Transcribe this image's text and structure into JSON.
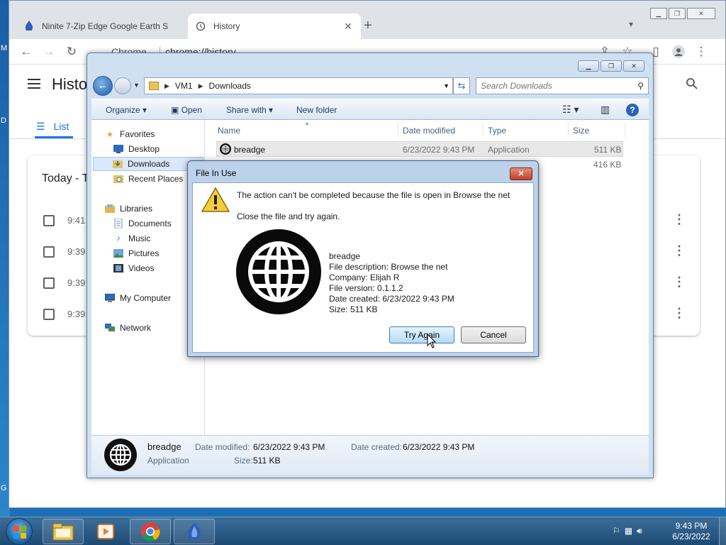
{
  "desktop": {
    "edge_labels": [
      "M",
      "D",
      "G"
    ]
  },
  "chrome": {
    "tabs": [
      {
        "title": "Ninite 7-Zip Edge Google Earth S",
        "active": false
      },
      {
        "title": "History",
        "active": true
      }
    ],
    "omnibox": {
      "site_label": "Chrome",
      "url": "chrome://history"
    },
    "history": {
      "title": "Histo",
      "tab_list_label": "List",
      "card_heading": "Today - T",
      "rows": [
        {
          "time": "9:41"
        },
        {
          "time": "9:39"
        },
        {
          "time": "9:39"
        },
        {
          "time": "9:39"
        }
      ]
    }
  },
  "explorer": {
    "breadcrumb": [
      "VM1",
      "Downloads"
    ],
    "search_placeholder": "Search Downloads",
    "commands": {
      "organize": "Organize",
      "open": "Open",
      "share": "Share with",
      "new_folder": "New folder"
    },
    "nav": {
      "favorites": "Favorites",
      "desktop": "Desktop",
      "downloads": "Downloads",
      "recent": "Recent Places",
      "libraries": "Libraries",
      "documents": "Documents",
      "music": "Music",
      "pictures": "Pictures",
      "videos": "Videos",
      "computer": "My Computer",
      "network": "Network"
    },
    "columns": {
      "name": "Name",
      "date": "Date modified",
      "type": "Type",
      "size": "Size"
    },
    "files": [
      {
        "name": "breadge",
        "date": "6/23/2022 9:43 PM",
        "type": "Application",
        "size": "511 KB"
      },
      {
        "name": "",
        "date": "",
        "type": "",
        "size": "416 KB"
      }
    ],
    "details": {
      "name": "breadge",
      "type": "Application",
      "date_modified_label": "Date modified:",
      "date_modified": "6/23/2022 9:43 PM",
      "size_label": "Size:",
      "size": "511 KB",
      "date_created_label": "Date created:",
      "date_created": "6/23/2022 9:43 PM"
    }
  },
  "dialog": {
    "title": "File In Use",
    "message": "The action can't be completed because the file is open in Browse the net",
    "instruction": "Close the file and try again.",
    "info": {
      "name": "breadge",
      "description": "File description: Browse the net",
      "company": "Company: Elijah R",
      "version": "File version: 0.1.1.2",
      "created": "Date created: 6/23/2022 9:43 PM",
      "size": "Size: 511 KB"
    },
    "try_again": "Try Again",
    "cancel": "Cancel"
  },
  "taskbar": {
    "time": "9:43 PM",
    "date": "6/23/2022"
  },
  "colors": {
    "accent": "#1a73e8",
    "taskbar": "#1d4a73",
    "dialog_frame": "#bcd1ea"
  }
}
